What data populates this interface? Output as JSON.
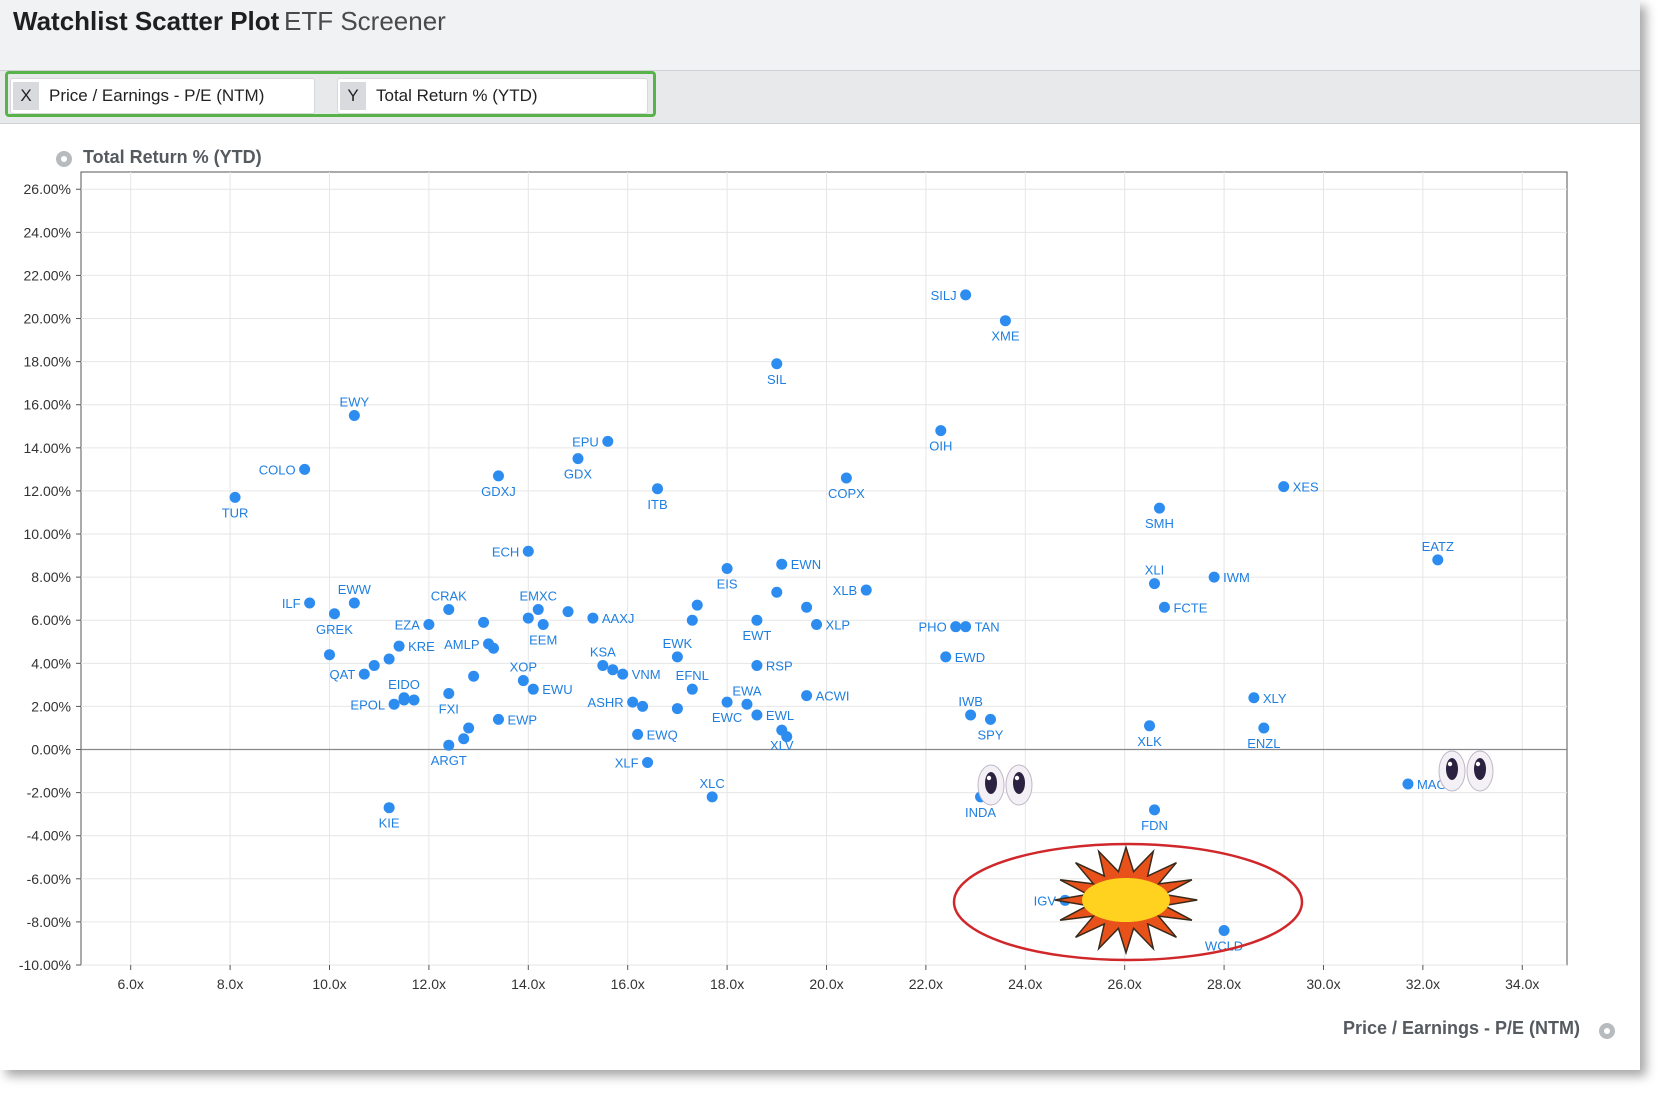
{
  "header": {
    "title": "Watchlist Scatter Plot",
    "subtitle": "ETF Screener"
  },
  "selectors": {
    "x": {
      "key": "X",
      "label": "Price / Earnings - P/E (NTM)"
    },
    "y": {
      "key": "Y",
      "label": "Total Return % (YTD)"
    }
  },
  "colors": {
    "point": "#2d8cf0",
    "label": "#1f7fe0",
    "highlight_box": "#57b34a",
    "callout_ellipse": "#d0272b"
  },
  "chart_data": {
    "type": "scatter",
    "xlabel": "Price / Earnings - P/E (NTM)",
    "ylabel": "Total Return % (YTD)",
    "xlim": [
      5.0,
      34.9
    ],
    "ylim": [
      -10.0,
      26.8
    ],
    "x_ticks": [
      "6.0x",
      "8.0x",
      "10.0x",
      "12.0x",
      "14.0x",
      "16.0x",
      "18.0x",
      "20.0x",
      "22.0x",
      "24.0x",
      "26.0x",
      "28.0x",
      "30.0x",
      "32.0x",
      "34.0x"
    ],
    "x_tick_values": [
      6,
      8,
      10,
      12,
      14,
      16,
      18,
      20,
      22,
      24,
      26,
      28,
      30,
      32,
      34
    ],
    "y_ticks": [
      "26.00%",
      "24.00%",
      "22.00%",
      "20.00%",
      "18.00%",
      "16.00%",
      "14.00%",
      "12.00%",
      "10.00%",
      "8.00%",
      "6.00%",
      "4.00%",
      "2.00%",
      "0.00%",
      "-2.00%",
      "-4.00%",
      "-6.00%",
      "-8.00%",
      "-10.00%"
    ],
    "y_tick_values": [
      26,
      24,
      22,
      20,
      18,
      16,
      14,
      12,
      10,
      8,
      6,
      4,
      2,
      0,
      -2,
      -4,
      -6,
      -8,
      -10
    ],
    "grid": true,
    "points": [
      {
        "label": "SILJ",
        "x": 22.8,
        "y": 21.1,
        "pos": "left"
      },
      {
        "label": "XME",
        "x": 23.6,
        "y": 19.9,
        "pos": "below"
      },
      {
        "label": "SIL",
        "x": 19.0,
        "y": 17.9,
        "pos": "below"
      },
      {
        "label": "EWY",
        "x": 10.5,
        "y": 15.5,
        "pos": "above"
      },
      {
        "label": "EPU",
        "x": 15.6,
        "y": 14.3,
        "pos": "left"
      },
      {
        "label": "OIH",
        "x": 22.3,
        "y": 14.8,
        "pos": "below"
      },
      {
        "label": "COLO",
        "x": 9.5,
        "y": 13.0,
        "pos": "left"
      },
      {
        "label": "GDX",
        "x": 15.0,
        "y": 13.5,
        "pos": "below"
      },
      {
        "label": "GDXJ",
        "x": 13.4,
        "y": 12.7,
        "pos": "below"
      },
      {
        "label": "COPX",
        "x": 20.4,
        "y": 12.6,
        "pos": "below"
      },
      {
        "label": "ITB",
        "x": 16.6,
        "y": 12.1,
        "pos": "below"
      },
      {
        "label": "TUR",
        "x": 8.1,
        "y": 11.7,
        "pos": "below"
      },
      {
        "label": "XES",
        "x": 29.2,
        "y": 12.2,
        "pos": "right"
      },
      {
        "label": "SMH",
        "x": 26.7,
        "y": 11.2,
        "pos": "below"
      },
      {
        "label": "ECH",
        "x": 14.0,
        "y": 9.2,
        "pos": "left"
      },
      {
        "label": "EATZ",
        "x": 32.3,
        "y": 8.8,
        "pos": "above"
      },
      {
        "label": "EWN",
        "x": 19.1,
        "y": 8.6,
        "pos": "right"
      },
      {
        "label": "EIS",
        "x": 18.0,
        "y": 8.4,
        "pos": "below"
      },
      {
        "label": "XLI",
        "x": 26.6,
        "y": 7.7,
        "pos": "above"
      },
      {
        "label": "IWM",
        "x": 27.8,
        "y": 8.0,
        "pos": "right"
      },
      {
        "label": "XLB",
        "x": 20.8,
        "y": 7.4,
        "pos": "left"
      },
      {
        "label": "FCTE",
        "x": 26.8,
        "y": 6.6,
        "pos": "right"
      },
      {
        "label": "ILF",
        "x": 9.6,
        "y": 6.8,
        "pos": "left"
      },
      {
        "label": "EWW",
        "x": 10.5,
        "y": 6.8,
        "pos": "above"
      },
      {
        "label": "GREK",
        "x": 10.1,
        "y": 6.3,
        "pos": "below"
      },
      {
        "label": "CRAK",
        "x": 12.4,
        "y": 6.5,
        "pos": "above"
      },
      {
        "label": "EMXC",
        "x": 14.2,
        "y": 6.5,
        "pos": "above"
      },
      {
        "label": "AAXJ",
        "x": 15.3,
        "y": 6.1,
        "pos": "right"
      },
      {
        "label": "EZA",
        "x": 12.0,
        "y": 5.8,
        "pos": "left"
      },
      {
        "label": "EEM",
        "x": 14.3,
        "y": 5.8,
        "pos": "below"
      },
      {
        "label": "EWT",
        "x": 18.6,
        "y": 6.0,
        "pos": "below"
      },
      {
        "label": "XLP",
        "x": 19.8,
        "y": 5.8,
        "pos": "right"
      },
      {
        "label": "PHO",
        "x": 22.6,
        "y": 5.7,
        "pos": "left"
      },
      {
        "label": "TAN",
        "x": 22.8,
        "y": 5.7,
        "pos": "right"
      },
      {
        "label": "KRE",
        "x": 11.4,
        "y": 4.8,
        "pos": "right"
      },
      {
        "label": "AMLP",
        "x": 13.2,
        "y": 4.9,
        "pos": "left"
      },
      {
        "label": "EWK",
        "x": 17.0,
        "y": 4.3,
        "pos": "above"
      },
      {
        "label": "KSA",
        "x": 15.5,
        "y": 3.9,
        "pos": "above"
      },
      {
        "label": "VNM",
        "x": 15.9,
        "y": 3.5,
        "pos": "right"
      },
      {
        "label": "RSP",
        "x": 18.6,
        "y": 3.9,
        "pos": "right"
      },
      {
        "label": "EWD",
        "x": 22.4,
        "y": 4.3,
        "pos": "right"
      },
      {
        "label": "QAT",
        "x": 10.7,
        "y": 3.5,
        "pos": "left"
      },
      {
        "label": "XOP",
        "x": 13.9,
        "y": 3.2,
        "pos": "above"
      },
      {
        "label": "EFNL",
        "x": 17.3,
        "y": 2.8,
        "pos": "above"
      },
      {
        "label": "EIDO",
        "x": 11.5,
        "y": 2.4,
        "pos": "above"
      },
      {
        "label": "EWU",
        "x": 14.1,
        "y": 2.8,
        "pos": "right"
      },
      {
        "label": "EWA",
        "x": 18.4,
        "y": 2.1,
        "pos": "above"
      },
      {
        "label": "ACWI",
        "x": 19.6,
        "y": 2.5,
        "pos": "right"
      },
      {
        "label": "XLY",
        "x": 28.6,
        "y": 2.4,
        "pos": "right"
      },
      {
        "label": "EPOL",
        "x": 11.3,
        "y": 2.1,
        "pos": "left"
      },
      {
        "label": "FXI",
        "x": 12.4,
        "y": 2.6,
        "pos": "below"
      },
      {
        "label": "ASHR",
        "x": 16.1,
        "y": 2.2,
        "pos": "left"
      },
      {
        "label": "EWC",
        "x": 18.0,
        "y": 2.2,
        "pos": "below"
      },
      {
        "label": "EWL",
        "x": 18.6,
        "y": 1.6,
        "pos": "right"
      },
      {
        "label": "IWB",
        "x": 22.9,
        "y": 1.6,
        "pos": "above"
      },
      {
        "label": "SPY",
        "x": 23.3,
        "y": 1.4,
        "pos": "below"
      },
      {
        "label": "EWP",
        "x": 13.4,
        "y": 1.4,
        "pos": "right"
      },
      {
        "label": "XLK",
        "x": 26.5,
        "y": 1.1,
        "pos": "below"
      },
      {
        "label": "ENZL",
        "x": 28.8,
        "y": 1.0,
        "pos": "below"
      },
      {
        "label": "EWQ",
        "x": 16.2,
        "y": 0.7,
        "pos": "right"
      },
      {
        "label": "XLV",
        "x": 19.1,
        "y": 0.9,
        "pos": "below"
      },
      {
        "label": "ARGT",
        "x": 12.4,
        "y": 0.2,
        "pos": "below"
      },
      {
        "label": "XLF",
        "x": 16.4,
        "y": -0.6,
        "pos": "left"
      },
      {
        "label": "XLC",
        "x": 17.7,
        "y": -2.2,
        "pos": "above"
      },
      {
        "label": "KIE",
        "x": 11.2,
        "y": -2.7,
        "pos": "below"
      },
      {
        "label": "INDA",
        "x": 23.1,
        "y": -2.2,
        "pos": "below"
      },
      {
        "label": "FDN",
        "x": 26.6,
        "y": -2.8,
        "pos": "below"
      },
      {
        "label": "MAGS",
        "x": 31.7,
        "y": -1.6,
        "pos": "right"
      },
      {
        "label": "IGV",
        "x": 24.8,
        "y": -7.0,
        "pos": "left"
      },
      {
        "label": "WCLD",
        "x": 28.0,
        "y": -8.4,
        "pos": "below"
      },
      {
        "label": "",
        "x": 10.0,
        "y": 4.4,
        "pos": "none"
      },
      {
        "label": "",
        "x": 10.9,
        "y": 3.9,
        "pos": "none"
      },
      {
        "label": "",
        "x": 11.2,
        "y": 4.2,
        "pos": "none"
      },
      {
        "label": "",
        "x": 11.5,
        "y": 2.3,
        "pos": "none"
      },
      {
        "label": "",
        "x": 11.7,
        "y": 2.3,
        "pos": "none"
      },
      {
        "label": "",
        "x": 12.9,
        "y": 3.4,
        "pos": "none"
      },
      {
        "label": "",
        "x": 13.1,
        "y": 5.9,
        "pos": "none"
      },
      {
        "label": "",
        "x": 13.3,
        "y": 4.7,
        "pos": "none"
      },
      {
        "label": "",
        "x": 12.8,
        "y": 1.0,
        "pos": "none"
      },
      {
        "label": "",
        "x": 12.7,
        "y": 0.5,
        "pos": "none"
      },
      {
        "label": "",
        "x": 14.0,
        "y": 6.1,
        "pos": "none"
      },
      {
        "label": "",
        "x": 14.8,
        "y": 6.4,
        "pos": "none"
      },
      {
        "label": "",
        "x": 15.7,
        "y": 3.7,
        "pos": "none"
      },
      {
        "label": "",
        "x": 16.3,
        "y": 2.0,
        "pos": "none"
      },
      {
        "label": "",
        "x": 17.0,
        "y": 1.9,
        "pos": "none"
      },
      {
        "label": "",
        "x": 17.4,
        "y": 6.7,
        "pos": "none"
      },
      {
        "label": "",
        "x": 17.3,
        "y": 6.0,
        "pos": "none"
      },
      {
        "label": "",
        "x": 19.0,
        "y": 7.3,
        "pos": "none"
      },
      {
        "label": "",
        "x": 19.6,
        "y": 6.6,
        "pos": "none"
      },
      {
        "label": "",
        "x": 19.2,
        "y": 0.6,
        "pos": "none"
      }
    ]
  }
}
